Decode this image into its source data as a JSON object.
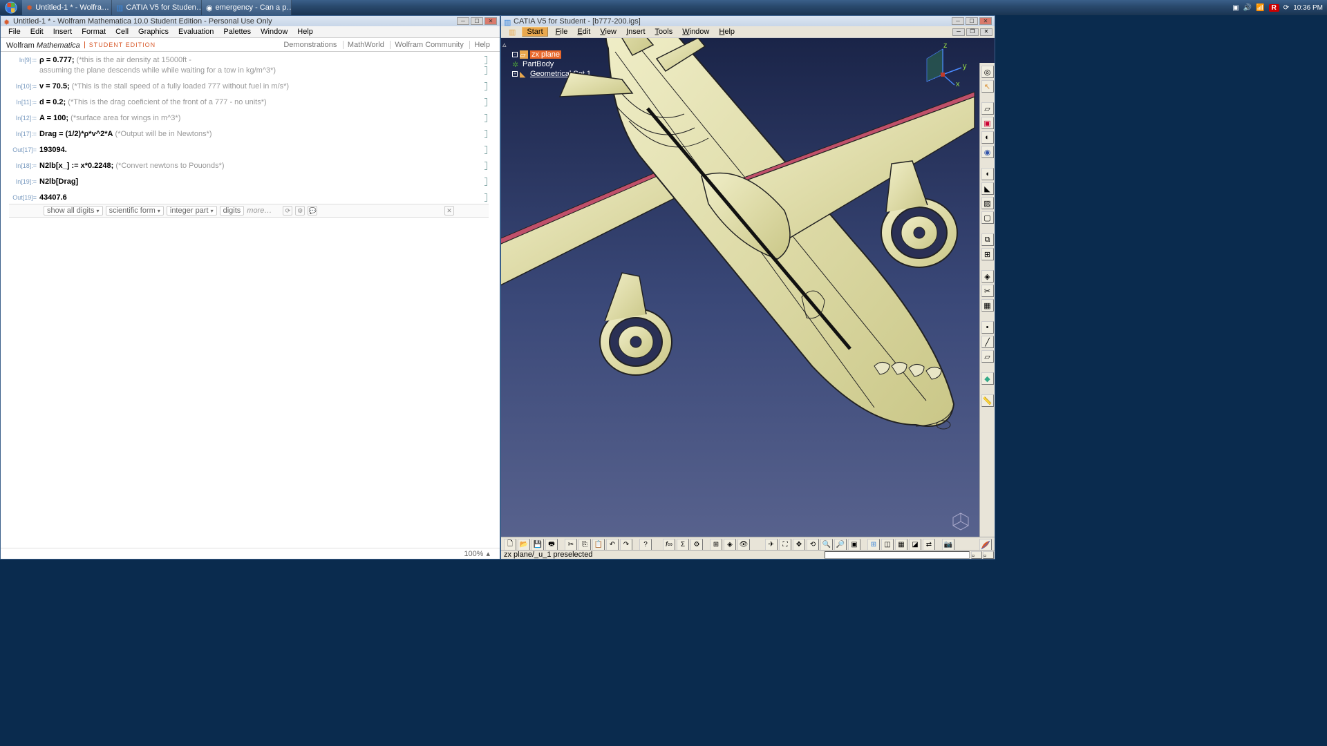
{
  "taskbar": {
    "items": [
      {
        "label": "Untitled-1 * - Wolfra…"
      },
      {
        "label": "CATIA V5 for Studen…"
      },
      {
        "label": "emergency - Can a p…"
      }
    ],
    "tray": {
      "red": "R",
      "time": "10:36 PM"
    }
  },
  "mathematica": {
    "title": "Untitled-1 * - Wolfram Mathematica 10.0 Student Edition - Personal Use Only",
    "menu": [
      "File",
      "Edit",
      "Insert",
      "Format",
      "Cell",
      "Graphics",
      "Evaluation",
      "Palettes",
      "Window",
      "Help"
    ],
    "logo_left": "Wolfram ",
    "logo_it": "Mathematica",
    "student": "STUDENT EDITION",
    "links": [
      "Demonstrations",
      "MathWorld",
      "Wolfram Community",
      "Help"
    ],
    "cells": [
      {
        "label": "In[9]:=",
        "bold": "ρ = 0.777;",
        "comment": " (*this is the air density at 15000ft - "
      },
      {
        "label": "",
        "bold": "",
        "comment": "assuming the plane descends while while waiting for a tow in kg/m^3*)"
      },
      {
        "label": "In[10]:=",
        "bold": "v = 70.5;",
        "comment": " (*This is the stall speed of a fully loaded 777 without fuel in m/s*)"
      },
      {
        "label": "In[11]:=",
        "bold": "d = 0.2;",
        "comment": " (*This is the drag coeficient of the front of a 777 - no units*)"
      },
      {
        "label": "In[12]:=",
        "bold": "A = 100;",
        "comment": " (*surface area for wings in m^3*)"
      },
      {
        "label": "In[17]:=",
        "bold": "Drag = (1/2)*ρ*v^2*A",
        "comment": " (*Output will be in Newtons*)"
      },
      {
        "label": "Out[17]=",
        "bold": "193094.",
        "comment": ""
      },
      {
        "label": "In[18]:=",
        "bold": "N2lb[x_] := x*0.2248;",
        "comment": " (*Convert newtons to Pouonds*)"
      },
      {
        "label": "In[19]:=",
        "bold": "N2lb[Drag]",
        "comment": ""
      },
      {
        "label": "Out[19]=",
        "bold": "43407.6",
        "comment": ""
      }
    ],
    "suggest": [
      "show all digits",
      "scientific form",
      "integer part",
      "digits"
    ],
    "more": "more…",
    "footer_zoom": "100%"
  },
  "catia": {
    "title": "CATIA V5 for Student - [b777-200.igs]",
    "menu": [
      "Start",
      "File",
      "Edit",
      "View",
      "Insert",
      "Tools",
      "Window",
      "Help"
    ],
    "tree": [
      {
        "label": "zx plane",
        "sel": true
      },
      {
        "label": "PartBody",
        "sel": false
      },
      {
        "label": "Geometrical Set.1",
        "sel": false,
        "ul": true
      }
    ],
    "axis": {
      "x": "x",
      "y": "y",
      "z": "z"
    },
    "status": "zx plane/_u_1 preselected"
  }
}
